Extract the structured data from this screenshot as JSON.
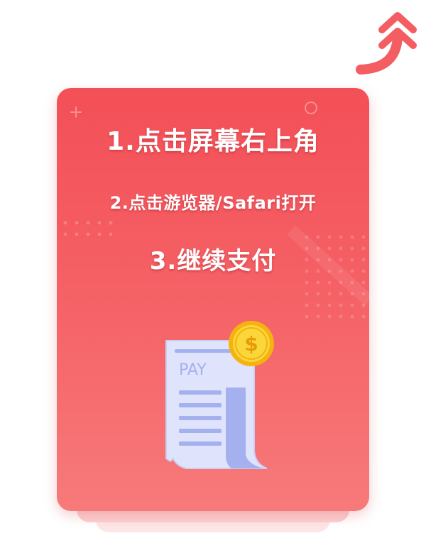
{
  "instructions": {
    "step_1": "1.点击屏幕右上角",
    "step_2": "2.点击游览器/Safari打开",
    "step_3": "3.继续支付"
  },
  "illustration": {
    "receipt_label": "PAY",
    "coin_symbol": "$",
    "receipt_icon": "receipt-icon",
    "coin_icon": "dollar-coin-icon"
  },
  "hint": {
    "arrow_icon": "up-arrow-icon"
  },
  "colors": {
    "card_top": "#f34f57",
    "card_bottom": "#f77a7a",
    "text": "#ffffff",
    "coin": "#f7c21b",
    "receipt_bg": "#dfe3fb",
    "receipt_lines": "#a5b1ee"
  }
}
